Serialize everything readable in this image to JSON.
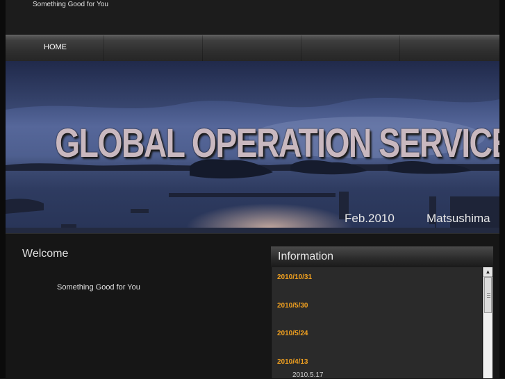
{
  "site": {
    "tagline": "Something Good for You"
  },
  "nav": {
    "items": [
      {
        "label": "HOME"
      }
    ]
  },
  "banner": {
    "title": "GLOBAL OPERATION SERVICE",
    "date": "Feb.2010",
    "place": "Matsushima"
  },
  "welcome": {
    "title": "Welcome",
    "text": "Something Good for You"
  },
  "information": {
    "title": "Information",
    "entries": [
      {
        "date": "2010/10/31"
      },
      {
        "date": "2010/5/30"
      },
      {
        "date": "2010/5/24"
      },
      {
        "date": "2010/4/13"
      }
    ],
    "sub_entry": "2010.5.17"
  },
  "colors": {
    "accent": "#f0a020",
    "background": "#1a1a1a"
  }
}
